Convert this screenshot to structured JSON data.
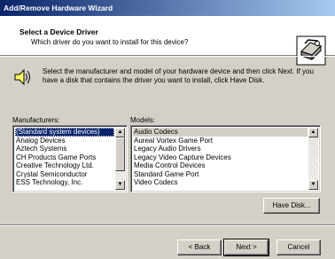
{
  "window": {
    "title": "Add/Remove Hardware Wizard"
  },
  "header": {
    "title": "Select a Device Driver",
    "subtitle": "Which driver do you want to install for this device?",
    "icon": "hardware-wizard-icon"
  },
  "instructions": {
    "text": "Select the manufacturer and model of your hardware device and then click Next. If you have a disk that contains the driver you want to install, click Have Disk.",
    "icon": "speaker-icon"
  },
  "manufacturers": {
    "label": "Manufacturers:",
    "items": [
      "(Standard system devices)",
      "Analog Devices",
      "Aztech Systems",
      "CH Products Game Ports",
      "Creative Technology Ltd.",
      "Crystal Semiconductor",
      "ESS Technology, Inc."
    ],
    "selected": "(Standard system devices)"
  },
  "models": {
    "label": "Models:",
    "items": [
      "Audio Codecs",
      "Aureal Vortex Game Port",
      "Legacy Audio Drivers",
      "Legacy Video Capture Devices",
      "Media Control Devices",
      "Standard Game Port",
      "Video Codecs"
    ],
    "selected": "Audio Codecs"
  },
  "buttons": {
    "have_disk": "Have Disk...",
    "back": "< Back",
    "next": "Next >",
    "cancel": "Cancel"
  }
}
